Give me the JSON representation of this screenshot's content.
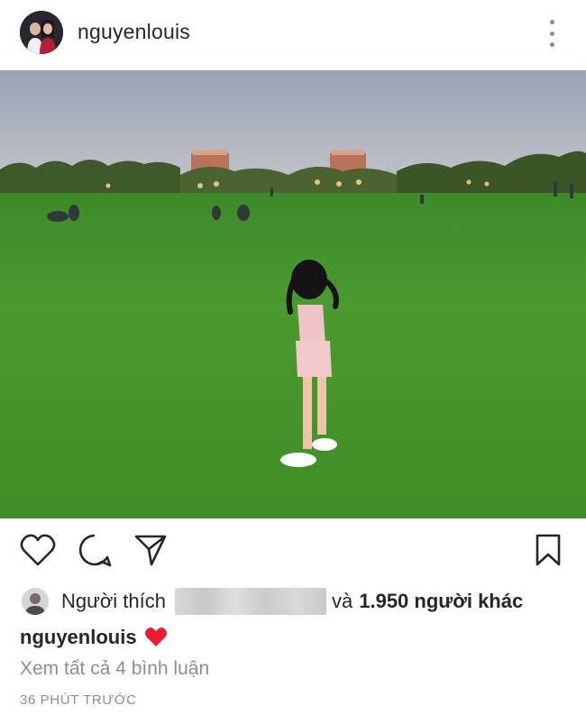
{
  "header": {
    "username": "nguyenlouis",
    "avatar_icon": "profile-avatar",
    "menu_icon": "more-vertical-icon"
  },
  "post": {
    "image_alt_icon": "post-photo"
  },
  "actions": {
    "like_icon": "heart-outline-icon",
    "comment_icon": "comment-icon",
    "share_icon": "send-icon",
    "save_icon": "bookmark-icon"
  },
  "likes": {
    "prefix": "Người thích",
    "conjunction": "và",
    "others": "1.950 người khác"
  },
  "caption": {
    "username": "nguyenlouis",
    "emoji_icon": "red-heart-emoji"
  },
  "comments": {
    "view_all": "Xem tất cả 4 bình luận"
  },
  "timestamp": "36 PHÚT TRƯỚC",
  "colors": {
    "text": "#262626",
    "muted": "#8e8e8e",
    "heart": "#ed4956"
  }
}
